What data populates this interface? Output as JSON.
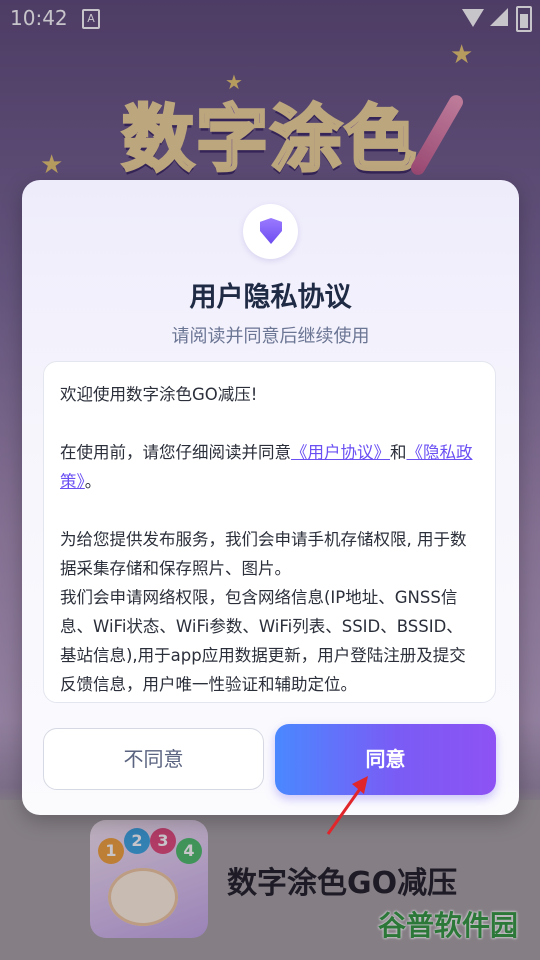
{
  "status_bar": {
    "time": "10:42",
    "notification_icon": "A"
  },
  "background": {
    "game_title": "数字涂色",
    "app_name": "数字涂色GO减压",
    "icon_numbers": [
      "1",
      "2",
      "3",
      "4"
    ],
    "watermark": "谷普软件园"
  },
  "dialog": {
    "icon": "shield-icon",
    "title": "用户隐私协议",
    "subtitle": "请阅读并同意后继续使用",
    "content": {
      "welcome": "欢迎使用数字涂色GO减压!",
      "intro_prefix": "在使用前，请您仔细阅读并同意",
      "user_agreement_link": "《用户协议》",
      "and_text": "和",
      "privacy_policy_link": "《隐私政策》",
      "intro_suffix": "。",
      "storage_permission": "为给您提供发布服务，我们会申请手机存储权限, 用于数据采集存储和保存照片、图片。",
      "network_permission": "我们会申请网络权限，包含网络信息(IP地址、GNSS信息、WiFi状态、WiFi参数、WiFi列表、SSID、BSSID、基站信息),用于app应用数据更新，用户登陆注册及提交反馈信息，用户唯一性验证和辅助定位。"
    },
    "disagree_label": "不同意",
    "agree_label": "同意"
  },
  "colors": {
    "accent_start": "#4a88ff",
    "accent_end": "#8e52f4",
    "link": "#6a4ff3",
    "watermark": "#2f9a3d"
  }
}
